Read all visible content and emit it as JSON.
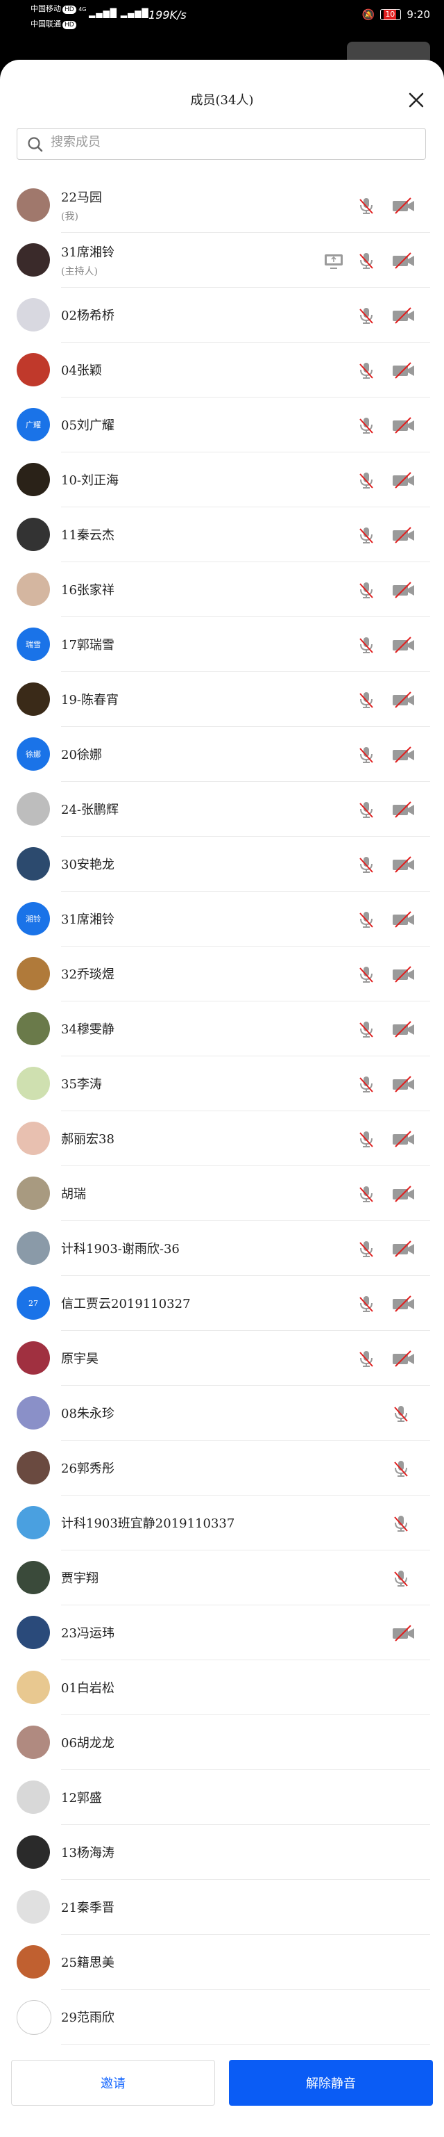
{
  "status": {
    "carrier1": "中国移动",
    "carrier2": "中国联通",
    "hd": "HD",
    "signal": "4G",
    "speed": "199K/s",
    "battery": "10",
    "time": "9:20"
  },
  "header": {
    "title": "成员(34人)"
  },
  "search": {
    "placeholder": "搜索成员"
  },
  "members": [
    {
      "name": "22马园",
      "sub": "(我)",
      "avatar": "#a0786c",
      "initials": "",
      "mic": true,
      "cam": true,
      "share": false
    },
    {
      "name": "31席湘铃",
      "sub": "(主持人)",
      "avatar": "#3a2a2a",
      "initials": "",
      "mic": true,
      "cam": true,
      "share": true
    },
    {
      "name": "02杨希桥",
      "sub": "",
      "avatar": "#d8d8e0",
      "initials": "",
      "mic": true,
      "cam": true,
      "share": false
    },
    {
      "name": "04张颖",
      "sub": "",
      "avatar": "#c0392b",
      "initials": "",
      "mic": true,
      "cam": true,
      "share": false
    },
    {
      "name": "05刘广耀",
      "sub": "",
      "avatar": "#1a73e8",
      "initials": "广耀",
      "mic": true,
      "cam": true,
      "share": false
    },
    {
      "name": "10-刘正海",
      "sub": "",
      "avatar": "#2a2218",
      "initials": "",
      "mic": true,
      "cam": true,
      "share": false
    },
    {
      "name": "11秦云杰",
      "sub": "",
      "avatar": "#333",
      "initials": "",
      "mic": true,
      "cam": true,
      "share": false
    },
    {
      "name": "16张家祥",
      "sub": "",
      "avatar": "#d4b6a0",
      "initials": "",
      "mic": true,
      "cam": true,
      "share": false
    },
    {
      "name": "17郭瑞雪",
      "sub": "",
      "avatar": "#1a73e8",
      "initials": "瑞雪",
      "mic": true,
      "cam": true,
      "share": false
    },
    {
      "name": "19-陈春宵",
      "sub": "",
      "avatar": "#3a2a18",
      "initials": "",
      "mic": true,
      "cam": true,
      "share": false
    },
    {
      "name": "20徐娜",
      "sub": "",
      "avatar": "#1a73e8",
      "initials": "徐娜",
      "mic": true,
      "cam": true,
      "share": false
    },
    {
      "name": "24-张鹏辉",
      "sub": "",
      "avatar": "#bdbdbd",
      "initials": "",
      "mic": true,
      "cam": true,
      "share": false
    },
    {
      "name": "30安艳龙",
      "sub": "",
      "avatar": "#2c4a6e",
      "initials": "",
      "mic": true,
      "cam": true,
      "share": false
    },
    {
      "name": "31席湘铃",
      "sub": "",
      "avatar": "#1a73e8",
      "initials": "湘铃",
      "mic": true,
      "cam": true,
      "share": false
    },
    {
      "name": "32乔琰煜",
      "sub": "",
      "avatar": "#b07a3a",
      "initials": "",
      "mic": true,
      "cam": true,
      "share": false
    },
    {
      "name": "34穆雯静",
      "sub": "",
      "avatar": "#6a7a4a",
      "initials": "",
      "mic": true,
      "cam": true,
      "share": false
    },
    {
      "name": "35李涛",
      "sub": "",
      "avatar": "#cfe0b0",
      "initials": "",
      "mic": true,
      "cam": true,
      "share": false
    },
    {
      "name": "郝丽宏38",
      "sub": "",
      "avatar": "#e8c0b0",
      "initials": "",
      "mic": true,
      "cam": true,
      "share": false
    },
    {
      "name": "胡瑞",
      "sub": "",
      "avatar": "#a89a80",
      "initials": "",
      "mic": true,
      "cam": true,
      "share": false
    },
    {
      "name": "计科1903-谢雨欣-36",
      "sub": "",
      "avatar": "#8a9aa8",
      "initials": "",
      "mic": true,
      "cam": true,
      "share": false
    },
    {
      "name": "信工贾云2019110327",
      "sub": "",
      "avatar": "#1a73e8",
      "initials": "27",
      "mic": true,
      "cam": true,
      "share": false
    },
    {
      "name": "原宇昊",
      "sub": "",
      "avatar": "#a03040",
      "initials": "",
      "mic": true,
      "cam": true,
      "share": false
    },
    {
      "name": "08朱永珍",
      "sub": "",
      "avatar": "#8a90c8",
      "initials": "",
      "mic": true,
      "cam": false,
      "share": false
    },
    {
      "name": "26郭秀彤",
      "sub": "",
      "avatar": "#6a4a40",
      "initials": "",
      "mic": true,
      "cam": false,
      "share": false
    },
    {
      "name": "计科1903班宜静2019110337",
      "sub": "",
      "avatar": "#4aa0e0",
      "initials": "",
      "mic": true,
      "cam": false,
      "share": false
    },
    {
      "name": "贾宇翔",
      "sub": "",
      "avatar": "#3a4a3a",
      "initials": "",
      "mic": true,
      "cam": false,
      "share": false
    },
    {
      "name": "23冯运玮",
      "sub": "",
      "avatar": "#2a4a7a",
      "initials": "",
      "mic": false,
      "cam": true,
      "share": false
    },
    {
      "name": "01白岩松",
      "sub": "",
      "avatar": "#e8c890",
      "initials": "",
      "mic": false,
      "cam": false,
      "share": false
    },
    {
      "name": "06胡龙龙",
      "sub": "",
      "avatar": "#b08a80",
      "initials": "",
      "mic": false,
      "cam": false,
      "share": false
    },
    {
      "name": "12郭盛",
      "sub": "",
      "avatar": "#d8d8d8",
      "initials": "",
      "mic": false,
      "cam": false,
      "share": false
    },
    {
      "name": "13杨海涛",
      "sub": "",
      "avatar": "#2a2a2a",
      "initials": "",
      "mic": false,
      "cam": false,
      "share": false
    },
    {
      "name": "21秦季晋",
      "sub": "",
      "avatar": "#e0e0e0",
      "initials": "",
      "mic": false,
      "cam": false,
      "share": false
    },
    {
      "name": "25籍思美",
      "sub": "",
      "avatar": "#c06030",
      "initials": "",
      "mic": false,
      "cam": false,
      "share": false
    },
    {
      "name": "29范雨欣",
      "sub": "",
      "avatar": "#ffffff",
      "initials": "",
      "mic": false,
      "cam": false,
      "share": false
    }
  ],
  "footer": {
    "invite_label": "邀请",
    "unmute_label": "解除静音"
  },
  "colors": {
    "primary": "#0a5cf5",
    "muted_red": "#e02020",
    "icon_gray": "#9a9a9a"
  }
}
